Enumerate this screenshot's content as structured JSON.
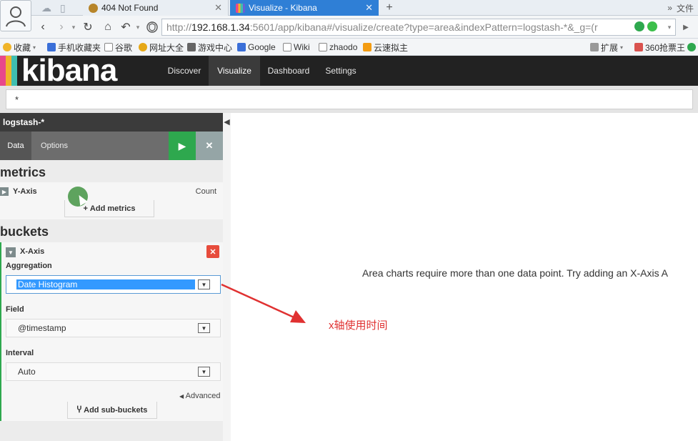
{
  "browser": {
    "tabs": [
      {
        "title": "404 Not Found",
        "active": false
      },
      {
        "title": "Visualize - Kibana",
        "active": true
      }
    ],
    "tabbar_right": {
      "more": "»",
      "file_menu": "文件"
    },
    "url": {
      "prefix": "http://",
      "host": "192.168.1.34",
      "rest": ":5601/app/kibana#/visualize/create?type=area&indexPattern=logstash-*&_g=(r"
    },
    "bookmarks": [
      {
        "label": "收藏"
      },
      {
        "label": "手机收藏夹"
      },
      {
        "label": "谷歌"
      },
      {
        "label": "网址大全"
      },
      {
        "label": "游戏中心"
      },
      {
        "label": "Google"
      },
      {
        "label": "Wiki"
      },
      {
        "label": "zhaodo"
      },
      {
        "label": "云速拟主"
      },
      {
        "label": "扩展"
      },
      {
        "label": "360抢票王"
      }
    ]
  },
  "kibana": {
    "logo": "kibana",
    "logo_colors": [
      "#e8488b",
      "#f0b429",
      "#3ebeb0",
      "#6b5fd6"
    ],
    "nav": [
      {
        "label": "Discover"
      },
      {
        "label": "Visualize",
        "active": true
      },
      {
        "label": "Dashboard"
      },
      {
        "label": "Settings"
      }
    ],
    "query": "*"
  },
  "sidebar": {
    "index_pattern": "logstash-*",
    "tabs": {
      "data": "Data",
      "options": "Options"
    },
    "icons": {
      "apply": "play-icon",
      "discard": "close-icon"
    },
    "metrics": {
      "heading": "metrics",
      "y_axis_label": "Y-Axis",
      "y_axis_value": "Count",
      "add_button": "Add metrics"
    },
    "buckets": {
      "heading": "buckets",
      "x_axis_label": "X-Axis",
      "aggregation_label": "Aggregation",
      "aggregation_value": "Date Histogram",
      "field_label": "Field",
      "field_value": "@timestamp",
      "interval_label": "Interval",
      "interval_value": "Auto",
      "advanced": "Advanced",
      "add_sub_buckets": "Add sub-buckets"
    }
  },
  "main": {
    "empty_message": "Area charts require more than one data point. Try adding an X-Axis A"
  },
  "annotation": {
    "text": "x轴使用时间",
    "color": "#e03131"
  }
}
